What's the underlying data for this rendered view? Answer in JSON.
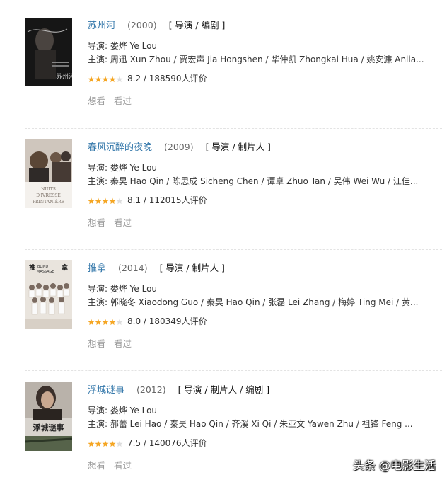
{
  "movies": [
    {
      "title": "苏州河",
      "year": "(2000)",
      "role": "[ 导演 / 编剧 ]",
      "director": "导演: 娄烨 Ye Lou",
      "cast": "主演: 周迅 Xun Zhou / 贾宏声 Jia Hongshen / 华仲凯 Zhongkai Hua / 姚安濂 Anlia...",
      "stars": 4,
      "score_text": "8.2 / 188590人评价",
      "actions": [
        "想看",
        "看过"
      ],
      "poster_colors": [
        "#1a1a1a",
        "#3a3a3a"
      ],
      "poster_text": "苏州河"
    },
    {
      "title": "春风沉醉的夜晚",
      "year": "(2009)",
      "role": "[ 导演 / 制片人 ]",
      "director": "导演: 娄烨 Ye Lou",
      "cast": "主演: 秦昊 Hao Qin / 陈思成 Sicheng Chen / 谭卓 Zhuo Tan / 吴伟 Wei Wu / 江佳...",
      "stars": 4,
      "score_text": "8.1 / 112015人评价",
      "actions": [
        "想看",
        "看过"
      ],
      "poster_colors": [
        "#f3f0ec",
        "#6b5a50"
      ],
      "poster_text": "NUITS D'IVRESSE PRINTANIÈRE"
    },
    {
      "title": "推拿",
      "year": "(2014)",
      "role": "[ 导演 / 制片人 ]",
      "director": "导演: 娄烨 Ye Lou",
      "cast": "主演: 郭晓冬 Xiaodong Guo / 秦昊 Hao Qin / 张磊 Lei Zhang / 梅婷 Ting Mei / 黄...",
      "stars": 4,
      "score_text": "8.0 / 180349人评价",
      "actions": [
        "想看",
        "看过"
      ],
      "poster_colors": [
        "#ece8e2",
        "#7a6a60"
      ],
      "poster_text": "推拿 BLIND MASSAGE"
    },
    {
      "title": "浮城谜事",
      "year": "(2012)",
      "role": "[ 导演 / 制片人 / 编剧 ]",
      "director": "导演: 娄烨 Ye Lou",
      "cast": "主演: 郝蕾 Lei Hao / 秦昊 Hao Qin / 齐溪 Xi Qi / 朱亚文 Yawen Zhu / 祖锋 Feng ...",
      "stars": 4,
      "score_text": "7.5 / 140076人评价",
      "actions": [
        "想看",
        "看过"
      ],
      "poster_colors": [
        "#d9d6d0",
        "#4a5a40"
      ],
      "poster_text": "浮城谜事"
    }
  ],
  "watermark": "头条 @电影生活",
  "colors": {
    "title": "#3377aa",
    "star": "#f5a623",
    "star_empty": "#dddddd",
    "muted": "#999999"
  }
}
